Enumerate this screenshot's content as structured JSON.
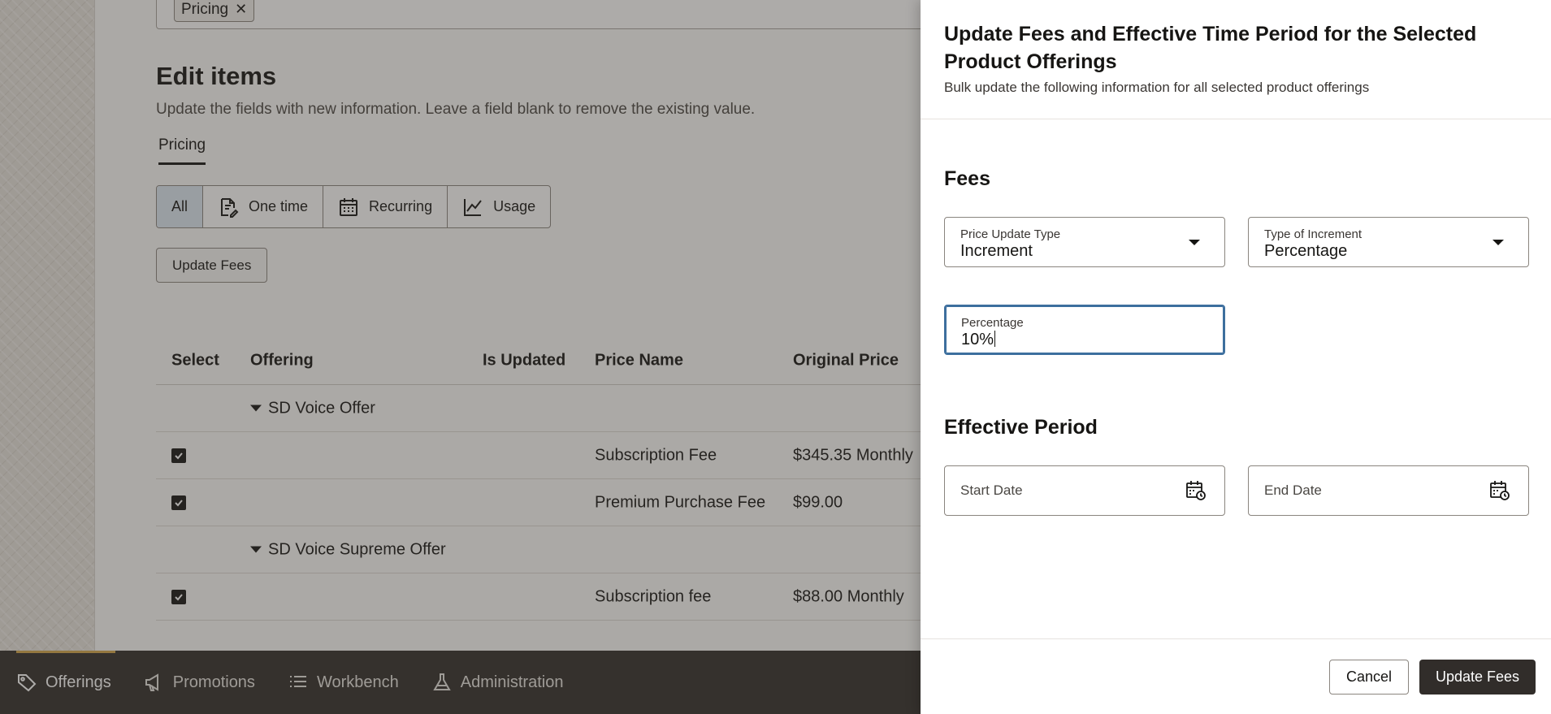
{
  "filter": {
    "chip_label": "Pricing",
    "chip_remove": "✕"
  },
  "edit": {
    "title": "Edit items",
    "description": "Update the fields with new information. Leave a field blank to remove the existing value.",
    "tab": "Pricing"
  },
  "segments": {
    "all": "All",
    "one_time": "One time",
    "recurring": "Recurring",
    "usage": "Usage"
  },
  "update_fees_button": "Update Fees",
  "table": {
    "headers": {
      "select": "Select",
      "offering": "Offering",
      "is_updated": "Is Updated",
      "price_name": "Price Name",
      "original_price": "Original Price"
    },
    "groups": [
      {
        "name": "SD Voice Offer",
        "rows": [
          {
            "checked": true,
            "price_name": "Subscription Fee",
            "original_price": "$345.35 Monthly"
          },
          {
            "checked": true,
            "price_name": "Premium Purchase Fee",
            "original_price": "$99.00"
          }
        ]
      },
      {
        "name": "SD Voice Supreme Offer",
        "rows": [
          {
            "checked": true,
            "price_name": "Subscription fee",
            "original_price": "$88.00 Monthly"
          }
        ]
      }
    ]
  },
  "bottom_nav": {
    "items": [
      {
        "label": "Offerings",
        "icon": "tag-icon",
        "active": true
      },
      {
        "label": "Promotions",
        "icon": "megaphone-icon",
        "active": false
      },
      {
        "label": "Workbench",
        "icon": "list-icon",
        "active": false
      },
      {
        "label": "Administration",
        "icon": "flask-icon",
        "active": false
      }
    ]
  },
  "drawer": {
    "title": "Update Fees and Effective Time Period for the Selected Product Offerings",
    "subtitle": "Bulk update the following information for all selected product offerings",
    "fees_section": "Fees",
    "price_update_type": {
      "label": "Price Update Type",
      "value": "Increment"
    },
    "type_of_increment": {
      "label": "Type of Increment",
      "value": "Percentage"
    },
    "percentage": {
      "label": "Percentage",
      "value": "10%"
    },
    "effective_section": "Effective Period",
    "start_date": {
      "placeholder": "Start Date"
    },
    "end_date": {
      "placeholder": "End Date"
    },
    "cancel": "Cancel",
    "submit": "Update Fees"
  },
  "colors": {
    "accent_focus": "#3d6f9e",
    "nav_bg": "#312d2a",
    "nav_active_bar": "#d5a84a",
    "primary_button": "#312d2a"
  }
}
